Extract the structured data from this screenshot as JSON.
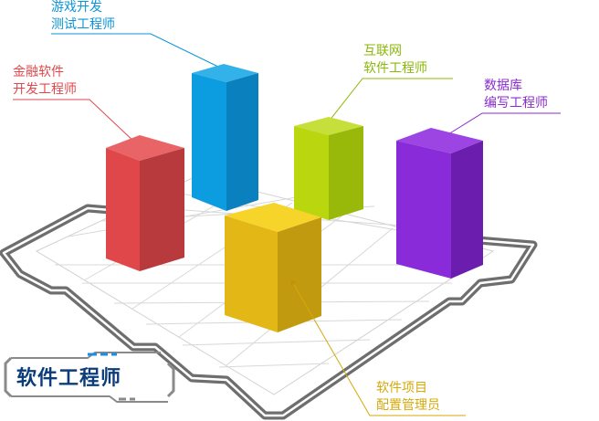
{
  "title": "软件工程师",
  "roles": [
    {
      "id": "finance",
      "lines": [
        "金融软件",
        "开发工程师"
      ],
      "color": "#e2474c"
    },
    {
      "id": "game",
      "lines": [
        "游戏开发",
        "测试工程师"
      ],
      "color": "#0b95d8"
    },
    {
      "id": "internet",
      "lines": [
        "互联网",
        "软件工程师"
      ],
      "color": "#8cb80a"
    },
    {
      "id": "database",
      "lines": [
        "数据库",
        "编写工程师"
      ],
      "color": "#8a2bd0"
    },
    {
      "id": "config",
      "lines": [
        "软件项目",
        "配置管理员"
      ],
      "color": "#d4a90a"
    }
  ]
}
